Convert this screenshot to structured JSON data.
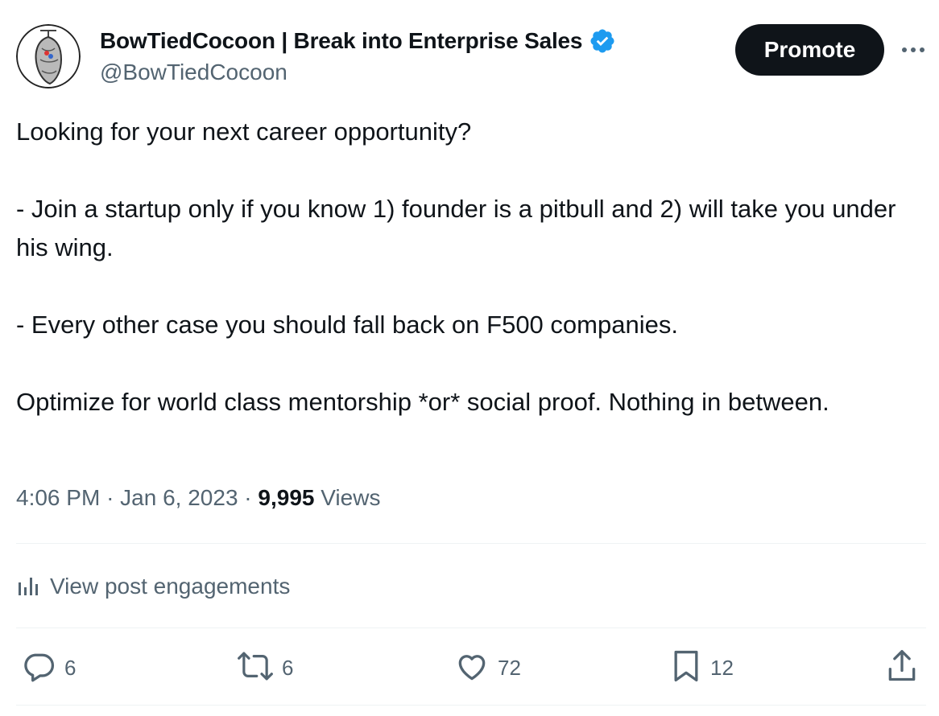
{
  "author": {
    "display_name": "BowTiedCocoon | Break into Enterprise Sales",
    "handle": "@BowTiedCocoon",
    "verified_color": "#1d9bf0"
  },
  "header": {
    "promote_label": "Promote",
    "more_icon": "ellipsis-icon"
  },
  "tweet": {
    "paragraphs": [
      "Looking for your next career opportunity?",
      "- Join a startup only if you know 1) founder is a pitbull and 2) will take you under his wing.",
      "- Every other case you should fall back on F500 companies.",
      "Optimize for world class mentorship *or* social proof. Nothing in between."
    ]
  },
  "meta": {
    "time": "4:06 PM",
    "separator": "·",
    "date": "Jan 6, 2023",
    "views_count": "9,995",
    "views_label": "Views"
  },
  "engagements": {
    "label": "View post engagements",
    "icon": "bar-chart-icon"
  },
  "actions": {
    "replies": "6",
    "reposts": "6",
    "likes": "72",
    "bookmarks": "12",
    "share_icon": "share-icon"
  },
  "colors": {
    "text_primary": "#0f1419",
    "text_secondary": "#536471",
    "divider": "#eff3f4",
    "button_bg": "#0f1419"
  }
}
